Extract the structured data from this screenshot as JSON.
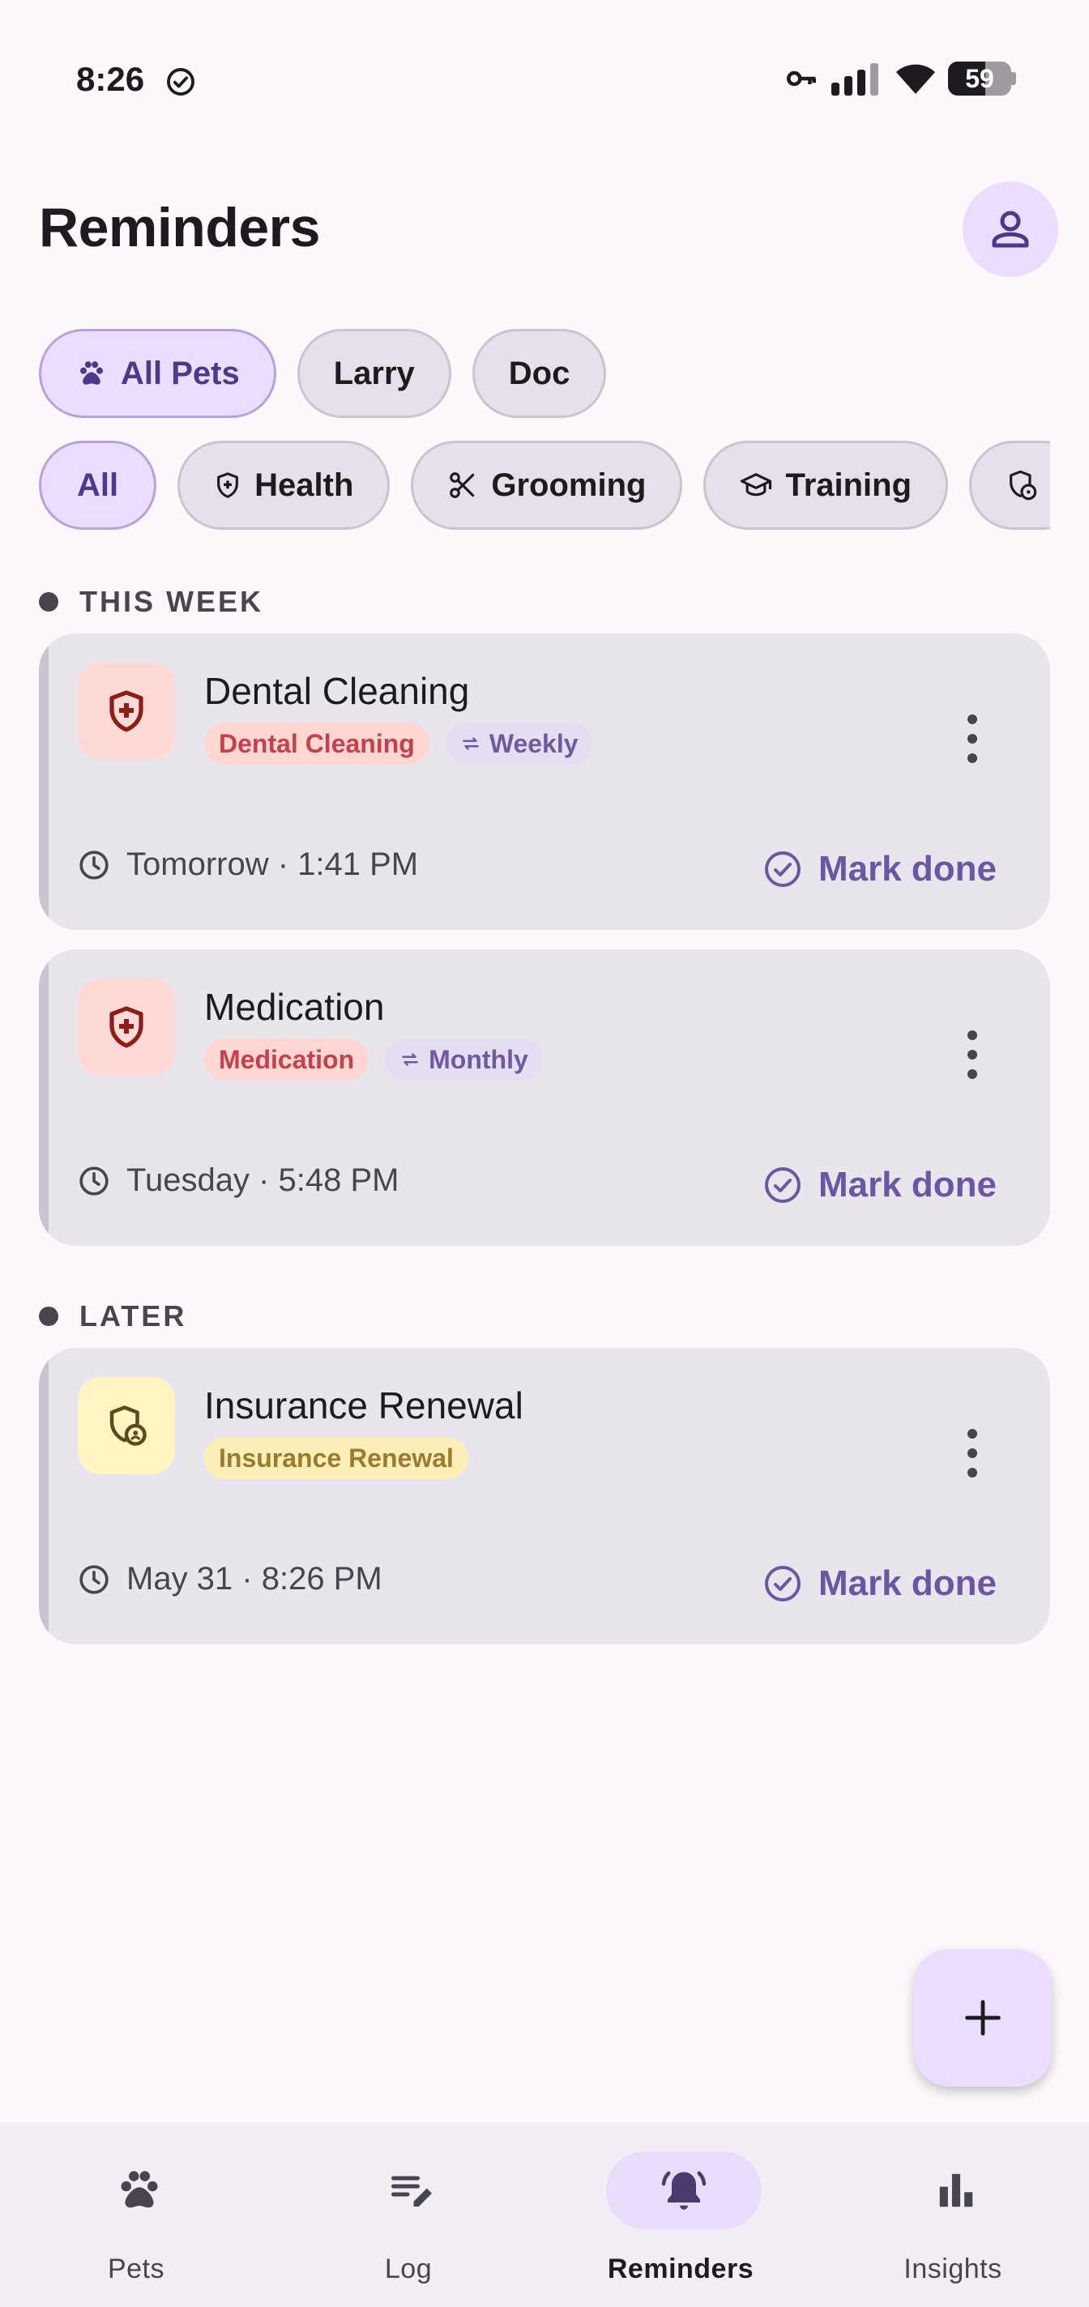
{
  "status_bar": {
    "time": "8:26",
    "battery": "59",
    "battery_level": 0.59,
    "icons": [
      "check-circle-icon",
      "vpn-key-icon",
      "signal-icon",
      "wifi-icon",
      "battery-icon"
    ]
  },
  "header": {
    "title": "Reminders",
    "profile_icon": "person-icon"
  },
  "pet_filters": [
    {
      "label": "All Pets",
      "icon": "paw-icon",
      "selected": true
    },
    {
      "label": "Larry",
      "selected": false
    },
    {
      "label": "Doc",
      "selected": false
    }
  ],
  "category_filters": [
    {
      "label": "All",
      "selected": true
    },
    {
      "label": "Health",
      "icon": "shield-icon",
      "selected": false
    },
    {
      "label": "Grooming",
      "icon": "scissors-icon",
      "selected": false
    },
    {
      "label": "Training",
      "icon": "school-icon",
      "selected": false
    },
    {
      "label": "",
      "icon": "insurance-icon",
      "selected": false
    }
  ],
  "sections": [
    {
      "title": "THIS WEEK",
      "items": [
        {
          "title": "Dental Cleaning",
          "category_tag": "Dental Cleaning",
          "repeat_tag": "Weekly",
          "time": "Tomorrow · 1:41 PM",
          "action": "Mark done",
          "icon": "health-shield-icon"
        },
        {
          "title": "Medication",
          "category_tag": "Medication",
          "repeat_tag": "Monthly",
          "time": "Tuesday · 5:48 PM",
          "action": "Mark done",
          "icon": "health-shield-icon"
        }
      ]
    },
    {
      "title": "LATER",
      "items": [
        {
          "title": "Insurance Renewal",
          "category_tag": "Insurance Renewal",
          "time": "May 31 · 8:26 PM",
          "action": "Mark done",
          "icon": "insurance-shield-icon"
        }
      ]
    }
  ],
  "fab": {
    "icon": "plus-icon"
  },
  "bottom_nav": [
    {
      "label": "Pets",
      "icon": "paw-icon",
      "active": false
    },
    {
      "label": "Log",
      "icon": "edit-note-icon",
      "active": false
    },
    {
      "label": "Reminders",
      "icon": "bell-icon",
      "active": true
    },
    {
      "label": "Insights",
      "icon": "bar-chart-icon",
      "active": false
    }
  ],
  "colors": {
    "background": "#FEF7FC",
    "accent": "#6B56A3",
    "selected_chip": "#EADDFF",
    "card": "#E9E5EC",
    "health_red": "#C4414C",
    "insurance_yellow": "#9C7B2E"
  }
}
